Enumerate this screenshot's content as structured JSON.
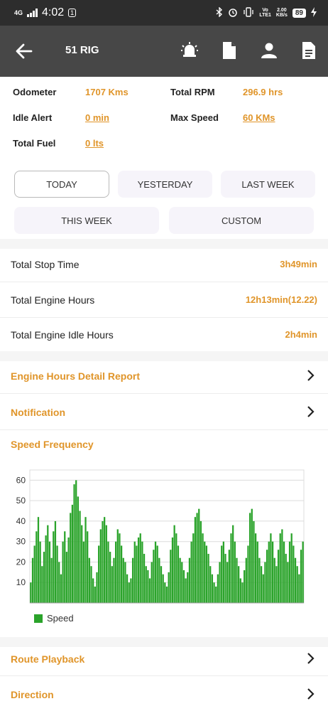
{
  "status_bar": {
    "network": "4G",
    "time": "4:02",
    "sim": "1",
    "lte": "LTE1",
    "speed": "2.00",
    "speed_unit": "KB/s",
    "battery": "89"
  },
  "app_bar": {
    "title": "51 RIG",
    "icons": [
      "back-arrow-icon",
      "alarm-icon",
      "document-icon",
      "person-icon",
      "report-icon"
    ]
  },
  "summary": {
    "odometer_label": "Odometer",
    "odometer_value": "1707 Kms",
    "total_rpm_label": "Total RPM",
    "total_rpm_value": "296.9 hrs",
    "idle_alert_label": "Idle Alert",
    "idle_alert_value": "0 min",
    "max_speed_label": "Max Speed",
    "max_speed_value": "60 KMs",
    "total_fuel_label": "Total Fuel",
    "total_fuel_value": "0 lts"
  },
  "range": {
    "today": "TODAY",
    "yesterday": "YESTERDAY",
    "last_week": "LAST WEEK",
    "this_week": "THIS WEEK",
    "custom": "CUSTOM",
    "selected": "TODAY"
  },
  "stats": {
    "stop_label": "Total Stop Time",
    "stop_value": "3h49min",
    "engine_label": "Total Engine Hours",
    "engine_value": "12h13min(12.22)",
    "idle_label": "Total Engine Idle Hours",
    "idle_value": "2h4min"
  },
  "links": {
    "engine_report": "Engine Hours Detail Report",
    "notification": "Notification",
    "route_playback": "Route Playback",
    "direction": "Direction"
  },
  "speed_section": {
    "title": "Speed Frequency"
  },
  "colors": {
    "accent": "#e0952a",
    "app_bar": "#474747",
    "status_bar": "#2d2d2d",
    "series": "#2aa32a"
  },
  "chart_data": {
    "type": "bar",
    "ylim": [
      0,
      65
    ],
    "yticks": [
      10,
      20,
      30,
      40,
      50,
      60
    ],
    "grid": true,
    "legend_position": "bottom-left",
    "series": [
      {
        "name": "Speed",
        "color": "#2aa32a",
        "values": [
          10,
          22,
          28,
          35,
          42,
          30,
          18,
          25,
          33,
          38,
          30,
          22,
          35,
          40,
          28,
          20,
          14,
          30,
          35,
          25,
          32,
          44,
          48,
          58,
          60,
          52,
          45,
          38,
          30,
          42,
          35,
          22,
          18,
          12,
          8,
          15,
          28,
          36,
          40,
          42,
          38,
          30,
          25,
          18,
          22,
          30,
          36,
          34,
          28,
          22,
          20,
          14,
          10,
          12,
          22,
          30,
          28,
          32,
          34,
          30,
          24,
          18,
          16,
          12,
          20,
          26,
          30,
          28,
          22,
          18,
          14,
          10,
          8,
          15,
          26,
          32,
          38,
          34,
          28,
          22,
          20,
          16,
          12,
          15,
          22,
          30,
          34,
          42,
          44,
          46,
          40,
          34,
          30,
          28,
          24,
          18,
          14,
          10,
          8,
          14,
          20,
          28,
          30,
          24,
          20,
          26,
          34,
          38,
          30,
          22,
          18,
          12,
          10,
          16,
          22,
          28,
          44,
          46,
          40,
          34,
          30,
          22,
          18,
          14,
          20,
          26,
          30,
          34,
          30,
          22,
          18,
          26,
          34,
          36,
          30,
          24,
          20,
          30,
          34,
          28,
          22,
          18,
          14,
          26,
          30
        ]
      }
    ]
  }
}
